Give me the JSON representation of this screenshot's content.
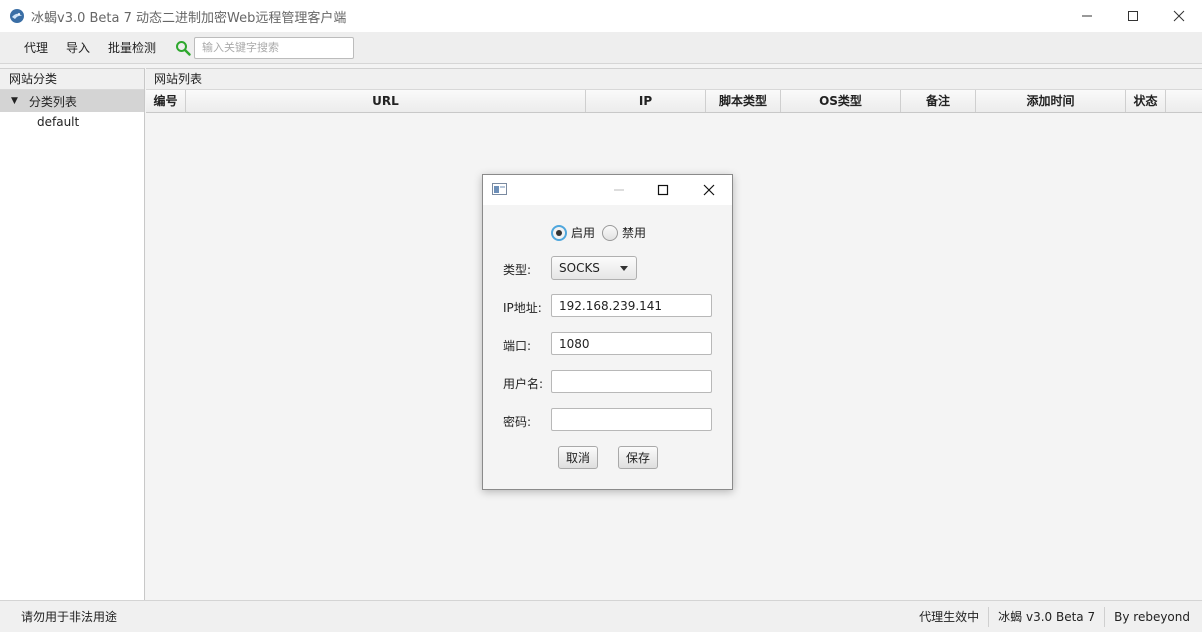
{
  "window": {
    "title": "冰蝎v3.0 Beta 7 动态二进制加密Web远程管理客户端"
  },
  "menu": {
    "items": [
      {
        "label": "代理"
      },
      {
        "label": "导入"
      },
      {
        "label": "批量检测"
      }
    ],
    "search_placeholder": "输入关键字搜索",
    "search_value": ""
  },
  "left_panel": {
    "title": "网站分类",
    "tree_root": "分类列表",
    "tree_children": [
      "default"
    ]
  },
  "right_panel": {
    "title": "网站列表",
    "columns": [
      "编号",
      "URL",
      "IP",
      "脚本类型",
      "OS类型",
      "备注",
      "添加时间",
      "状态"
    ],
    "rows": []
  },
  "status_bar": {
    "left": "请勿用于非法用途",
    "proxy_status": "代理生效中",
    "version": "冰蝎 v3.0 Beta 7",
    "author": "By rebeyond"
  },
  "proxy_dialog": {
    "enable_label": "启用",
    "disable_label": "禁用",
    "enabled": true,
    "type_label": "类型:",
    "type_value": "SOCKS",
    "ip_label": "IP地址:",
    "ip_value": "192.168.239.141",
    "port_label": "端口:",
    "port_value": "1080",
    "username_label": "用户名:",
    "username_value": "",
    "password_label": "密码:",
    "password_value": "",
    "cancel_label": "取消",
    "save_label": "保存"
  },
  "colors": {
    "radio_focus": "#4fa7dd",
    "search_icon": "#2ea82e"
  }
}
